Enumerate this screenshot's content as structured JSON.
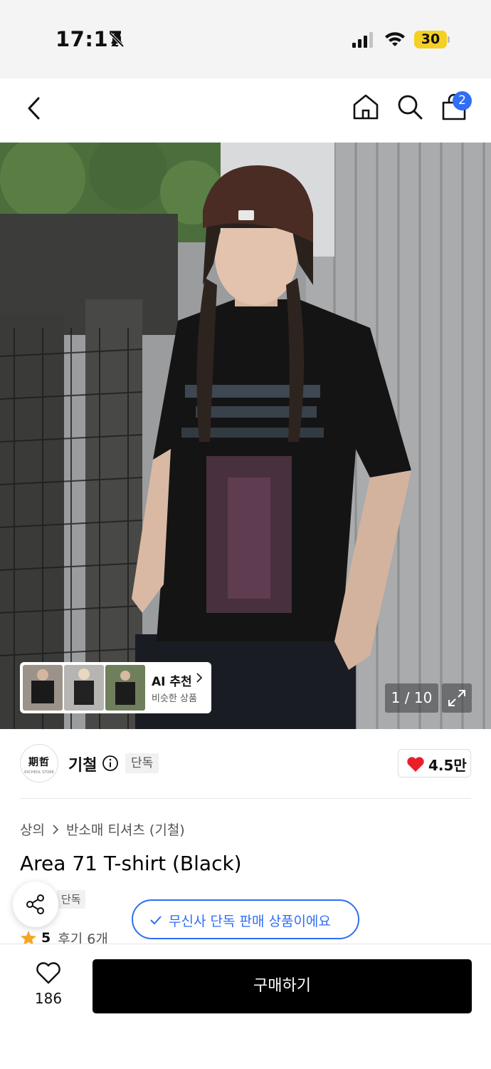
{
  "status_bar": {
    "time": "17:17",
    "battery": "30",
    "battery_color": "#f5cf24"
  },
  "nav": {
    "cart_badge": "2",
    "icons": [
      "back-icon",
      "home-icon",
      "search-icon",
      "shopping-bag-icon"
    ]
  },
  "hero": {
    "ai_recommend": {
      "title": "AI 추천",
      "subtitle": "비슷한 상품"
    },
    "page_indicator": "1 / 10"
  },
  "brand": {
    "logo_text": "期哲",
    "logo_sub": "KIICHEOL STORE",
    "name": "기철",
    "tag": "단독",
    "likes": "4.5만"
  },
  "product": {
    "breadcrumb": [
      "상의",
      "반소매 티셔츠 (기철)"
    ],
    "title": "Area 71 T-shirt (Black)",
    "tag": "단독",
    "rating": "5",
    "reviews": "후기 6개"
  },
  "toast": {
    "text": "무신사 단독 판매 상품이에요"
  },
  "bottom_bar": {
    "wish_count": "186",
    "buy_label": "구매하기"
  },
  "colors": {
    "accent": "#2f6ef5",
    "heart": "#e8202a",
    "buy_button": "#000000"
  }
}
